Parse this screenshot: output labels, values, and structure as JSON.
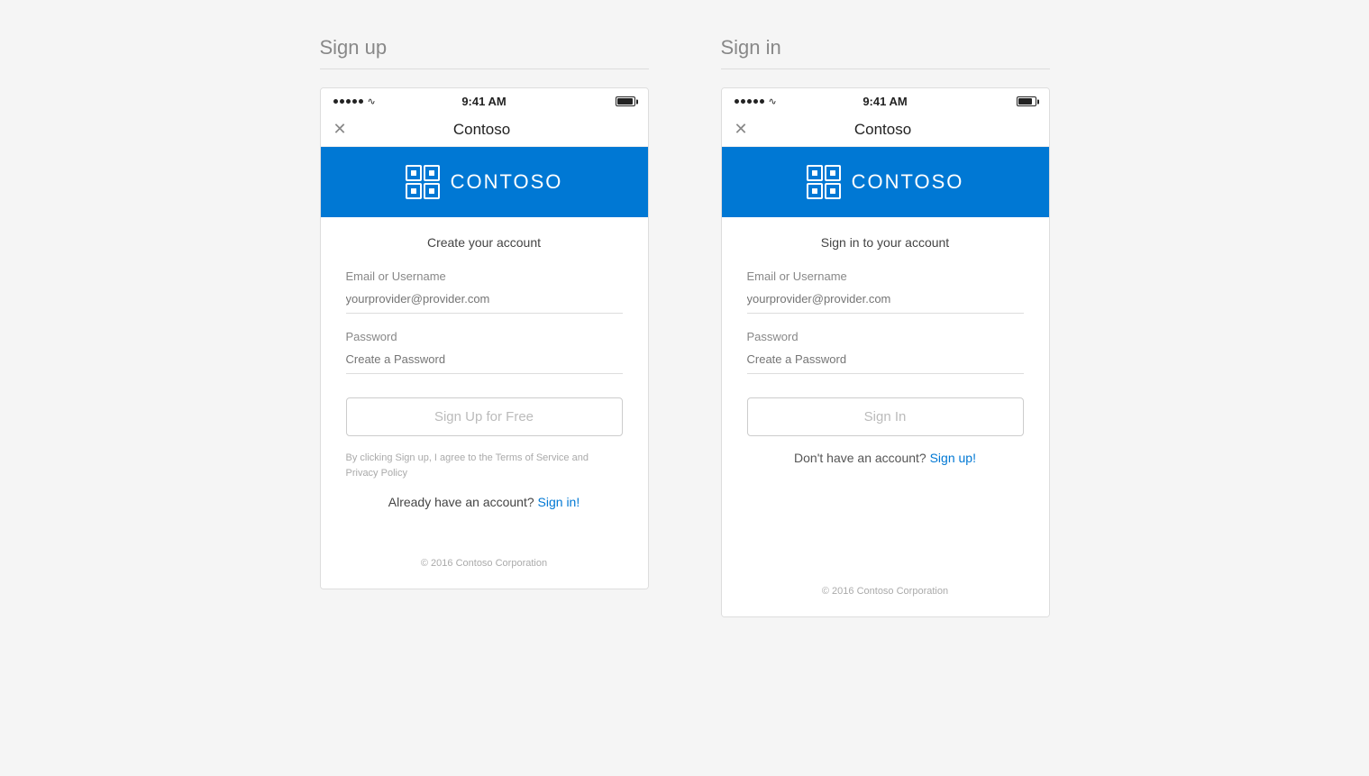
{
  "signup": {
    "title": "Sign up",
    "statusBar": {
      "time": "9:41 AM"
    },
    "navTitle": "Contoso",
    "brandName": "CONTOSO",
    "formHeading": "Create your account",
    "emailLabel": "Email or Username",
    "emailPlaceholder": "yourprovider@provider.com",
    "passwordLabel": "Password",
    "passwordPlaceholder": "Create a Password",
    "submitBtn": "Sign Up for Free",
    "termsText": "By clicking Sign up, I agree to the Terms of Service and Privacy Policy",
    "bottomLinkText": "Already have an account?",
    "bottomLinkAction": "Sign in!",
    "footerText": "© 2016 Contoso Corporation"
  },
  "signin": {
    "title": "Sign in",
    "statusBar": {
      "time": "9:41 AM"
    },
    "navTitle": "Contoso",
    "brandName": "CONTOSO",
    "formHeading": "Sign in to your account",
    "emailLabel": "Email or Username",
    "emailPlaceholder": "yourprovider@provider.com",
    "passwordLabel": "Password",
    "passwordPlaceholder": "Create a Password",
    "submitBtn": "Sign In",
    "dontHaveText": "Don't have an account?",
    "dontHaveAction": "Sign up!",
    "footerText": "© 2016 Contoso Corporation"
  }
}
